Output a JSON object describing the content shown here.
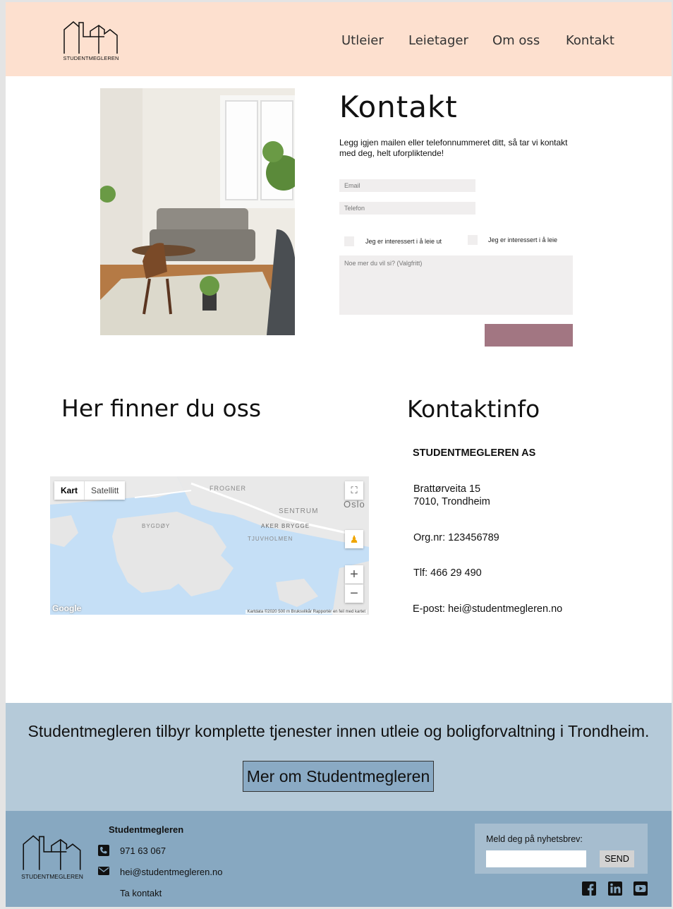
{
  "header": {
    "logo_text": "STUDENTMEGLEREN",
    "nav": [
      "Utleier",
      "Leietager",
      "Om oss",
      "Kontakt"
    ]
  },
  "contact_form": {
    "title": "Kontakt",
    "intro": "Legg igjen mailen eller telefonnummeret ditt, så tar vi kontakt med deg, helt uforpliktende!",
    "email_placeholder": "Email",
    "phone_placeholder": "Telefon",
    "checkbox_rent_out": "Jeg er interessert i å leie ut",
    "checkbox_rent": "Jeg er interessert i å  leie",
    "message_placeholder": "Noe mer du vil si? (Valgfritt)",
    "submit_label": ""
  },
  "find_us": {
    "title": "Her finner du oss",
    "map": {
      "tab_map": "Kart",
      "tab_satellite": "Satellitt",
      "labels": [
        "FROGNER",
        "SENTRUM",
        "Oslo",
        "BYGDØY",
        "AKER BRYGGE",
        "TJUVHOLMEN"
      ],
      "google": "Google",
      "attribution": "Kartdata ©2020   500 m        Bruksvilkår   Rapportér en feil med kartet",
      "zoom_in": "+",
      "zoom_out": "−"
    }
  },
  "contact_info": {
    "title": "Kontaktinfo",
    "company": "STUDENTMEGLEREN AS",
    "street": "Brattørveita 15",
    "city": "7010, Trondheim",
    "org": "Org.nr: 123456789",
    "phone": "Tlf: 466 29 490",
    "email": "E-post: hei@studentmegleren.no"
  },
  "band": {
    "text": "Studentmegleren tilbyr komplette tjenester innen utleie og boligforvaltning i Trondheim.",
    "button": "Mer om Studentmegleren"
  },
  "footer": {
    "logo_text": "STUDENTMEGLEREN",
    "title": "Studentmegleren",
    "phone": "971 63 067",
    "email": "hei@studentmegleren.no",
    "contact_link": "Ta kontakt",
    "newsletter_label": "Meld deg på nyhetsbrev:",
    "newsletter_send": "SEND",
    "social_icons": [
      "facebook-icon",
      "linkedin-icon",
      "youtube-icon"
    ]
  },
  "colors": {
    "header_bg": "#fde0cf",
    "submit_bg": "#a27682",
    "band_bg": "#b5cad9",
    "footer_bg": "#87a8c1",
    "button_bg": "#8aaac4"
  }
}
